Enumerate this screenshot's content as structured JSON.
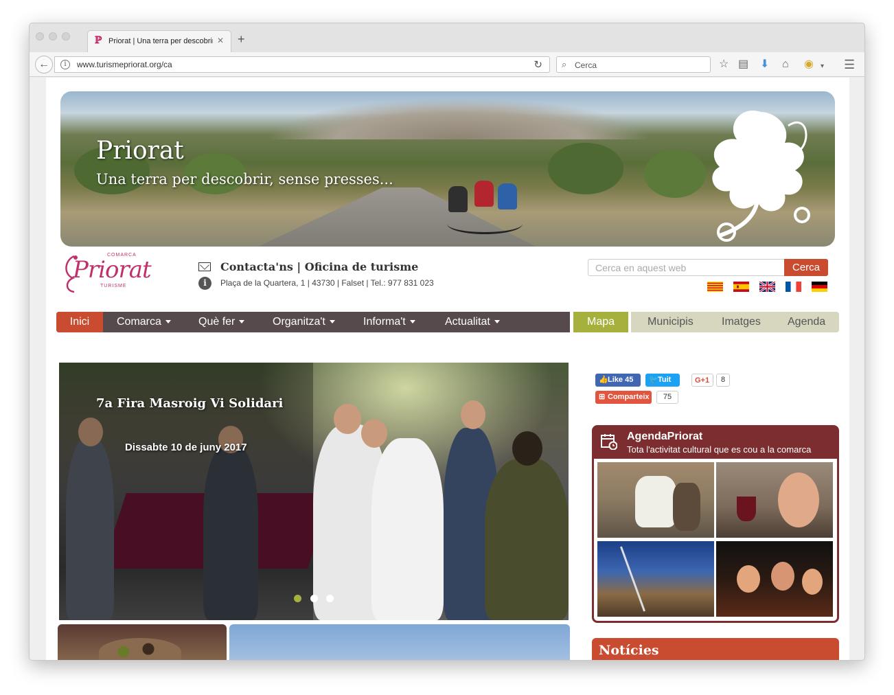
{
  "browser": {
    "tab_title": "Priorat | Una terra per descobrir, sense presses...",
    "url": "www.turismepriorat.org/ca",
    "search_placeholder": "Cerca"
  },
  "banner": {
    "title": "Priorat",
    "subtitle": "Una terra per descobrir, sense presses..."
  },
  "logo": {
    "name": "Priorat",
    "top_text": "COMARCA",
    "bottom_text": "TURISME"
  },
  "contact": {
    "title": "Contacta'ns | Oficina de turisme",
    "address": "Plaça de la Quartera, 1  |  43730  |  Falset  |  Tel.: 977 831 023"
  },
  "site_search": {
    "placeholder": "Cerca en aquest web",
    "button": "Cerca"
  },
  "languages": [
    "català",
    "español",
    "english",
    "français",
    "deutsch"
  ],
  "nav": {
    "home": "Inici",
    "items": [
      "Comarca",
      "Què fer",
      "Organitza't",
      "Informa't",
      "Actualitat"
    ],
    "map": "Mapa",
    "secondary": [
      "Municipis",
      "Imatges",
      "Agenda"
    ]
  },
  "slider": {
    "title": "7a Fira Masroig Vi Solidari",
    "date": "Dissabte 10 de juny 2017",
    "slides": 3,
    "active_slide": 1
  },
  "social": {
    "like_label": "Like",
    "like_count": "45",
    "tweet_label": "Tuit",
    "gplus_label": "G+1",
    "gplus_count": "8",
    "share_label": "Comparteix",
    "share_count": "75"
  },
  "agenda": {
    "title": "AgendaPriorat",
    "subtitle": "Tota l'activitat cultural que es cou a la comarca"
  },
  "news": {
    "title": "Notícies"
  },
  "colors": {
    "accent": "#c94b30",
    "nav_bg": "#564a4d",
    "map_green": "#a6b13d",
    "secondary_bg": "#d7d6bf",
    "agenda": "#7b2d2f",
    "logo": "#c0306a"
  }
}
